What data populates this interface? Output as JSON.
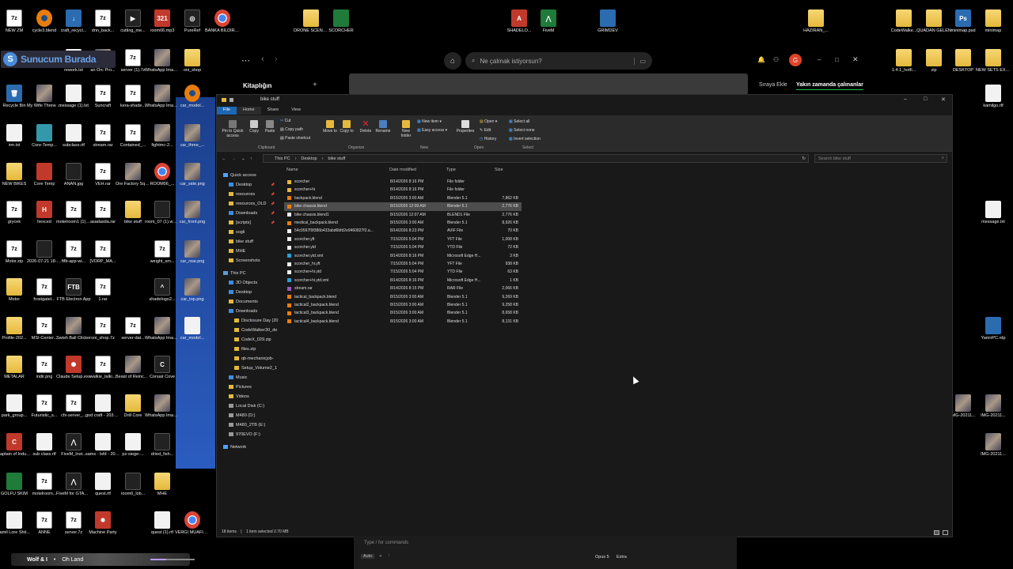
{
  "desktop_icons": [
    {
      "label": "NEW ZM",
      "kind": "z7",
      "glyph": "7z"
    },
    {
      "label": "cycle3.blend",
      "kind": "blender",
      "glyph": ""
    },
    {
      "label": "craft_recycl...",
      "kind": "blue",
      "glyph": "↓"
    },
    {
      "label": "dnn_back...",
      "kind": "z7",
      "glyph": "7z"
    },
    {
      "label": "cutting_me...",
      "kind": "dark",
      "glyph": "▶"
    },
    {
      "label": "room06.mp3",
      "kind": "red",
      "glyph": "321"
    },
    {
      "label": "PureRef",
      "kind": "dark",
      "glyph": "◎"
    },
    {
      "label": "BANKA BILDIRIM.pdf",
      "kind": "chrome",
      "glyph": ""
    },
    {
      "label": "DRONE SCENARIOS",
      "kind": "folder",
      "glyph": ""
    },
    {
      "label": "SCORCHER",
      "kind": "green",
      "glyph": ""
    },
    {
      "label": "SHADELO...",
      "kind": "red",
      "glyph": "A"
    },
    {
      "label": "FiveM",
      "kind": "green",
      "glyph": "⋀"
    },
    {
      "label": "GRIMDEV",
      "kind": "blue",
      "glyph": ""
    },
    {
      "label": "HAZIRAN_...",
      "kind": "folder",
      "glyph": ""
    },
    {
      "label": "CodeWalke...",
      "kind": "folder",
      "glyph": ""
    },
    {
      "label": "QUADAN GELEN",
      "kind": "folder",
      "glyph": ""
    },
    {
      "label": "minimap.psd",
      "kind": "blue",
      "glyph": "Ps"
    },
    {
      "label": "minimap",
      "kind": "folder",
      "glyph": ""
    },
    {
      "label": "rework.txt",
      "kind": "file",
      "glyph": ""
    },
    {
      "label": "an Orc Pro...",
      "kind": "img",
      "glyph": ""
    },
    {
      "label": "server (1).7z",
      "kind": "z7",
      "glyph": "7z"
    },
    {
      "label": "WhatsApp Image 2026...",
      "kind": "img",
      "glyph": ""
    },
    {
      "label": "oni_shop",
      "kind": "folder",
      "glyph": ""
    },
    {
      "label": "1.4.1_hotfi...",
      "kind": "folder",
      "glyph": ""
    },
    {
      "label": "zip",
      "kind": "folder",
      "glyph": ""
    },
    {
      "label": "DESKTOP",
      "kind": "folder",
      "glyph": ""
    },
    {
      "label": "NEW SETS EXPORT",
      "kind": "folder",
      "glyph": ""
    },
    {
      "label": "Recycle Bin",
      "kind": "blue",
      "glyph": "🗑"
    },
    {
      "label": "My Wife Threw Out...",
      "kind": "img",
      "glyph": ""
    },
    {
      "label": "message (1).txt",
      "kind": "file",
      "glyph": ""
    },
    {
      "label": "Suncraft",
      "kind": "z7",
      "glyph": "7z"
    },
    {
      "label": "kera-shade...",
      "kind": "z7",
      "glyph": "7z"
    },
    {
      "label": "WhatsApp Image 2026...",
      "kind": "img",
      "glyph": ""
    },
    {
      "label": "car_model...",
      "kind": "blender",
      "glyph": ""
    },
    {
      "label": "kamilgo.rtf",
      "kind": "file",
      "glyph": ""
    },
    {
      "label": "irm.txt",
      "kind": "file",
      "glyph": ""
    },
    {
      "label": "Core-Temp...",
      "kind": "exe",
      "glyph": ""
    },
    {
      "label": "subclass.rtf",
      "kind": "file",
      "glyph": ""
    },
    {
      "label": "stream.rar",
      "kind": "z7",
      "glyph": "7z"
    },
    {
      "label": "Contained_...",
      "kind": "z7",
      "glyph": "7z"
    },
    {
      "label": "fightmc-2...",
      "kind": "img",
      "glyph": ""
    },
    {
      "label": "car_three_...",
      "kind": "img",
      "glyph": ""
    },
    {
      "label": "NEW BIKES",
      "kind": "folder",
      "glyph": ""
    },
    {
      "label": "Core Temp",
      "kind": "red",
      "glyph": ""
    },
    {
      "label": "ANAN.jpg",
      "kind": "dark",
      "glyph": ""
    },
    {
      "label": "VEH.rar",
      "kind": "z7",
      "glyph": "7z"
    },
    {
      "label": "Ore Factory Squad -...",
      "kind": "img",
      "glyph": ""
    },
    {
      "label": "ROOM06_...",
      "kind": "chrome",
      "glyph": ""
    },
    {
      "label": "car_side.png",
      "kind": "img",
      "glyph": ""
    },
    {
      "label": "grycek",
      "kind": "z7",
      "glyph": "7z"
    },
    {
      "label": "hexced",
      "kind": "red",
      "glyph": "H"
    },
    {
      "label": "motelroom1 (1).rar",
      "kind": "z7",
      "glyph": "7z"
    },
    {
      "label": "asadasda.rar",
      "kind": "z7",
      "glyph": "7z"
    },
    {
      "label": "bike stuff",
      "kind": "folder",
      "glyph": ""
    },
    {
      "label": "room_07 (1).webm",
      "kind": "dark",
      "glyph": ""
    },
    {
      "label": "car_front.png",
      "kind": "img",
      "glyph": ""
    },
    {
      "label": "message.txt",
      "kind": "file",
      "glyph": ""
    },
    {
      "label": "Motor.zip",
      "kind": "z7",
      "glyph": "7z"
    },
    {
      "label": "2026-07-21 18-19-18_7...",
      "kind": "dark",
      "glyph": ""
    },
    {
      "label": "ftfb-app-wi...",
      "kind": "z7",
      "glyph": "7z"
    },
    {
      "label": "[VORP_MA...",
      "kind": "z7",
      "glyph": "7z"
    },
    {
      "label": "weight_sm...",
      "kind": "z7",
      "glyph": "7z"
    },
    {
      "label": "car_rear.png",
      "kind": "img",
      "glyph": ""
    },
    {
      "label": "Motor",
      "kind": "folder",
      "glyph": ""
    },
    {
      "label": "frostgatel...",
      "kind": "z7",
      "glyph": "7z"
    },
    {
      "label": "FTB Electron App",
      "kind": "dark",
      "glyph": "FTB"
    },
    {
      "label": "1.rar",
      "kind": "z7",
      "glyph": "7z"
    },
    {
      "label": "shadelogo2...",
      "kind": "dark",
      "glyph": "^"
    },
    {
      "label": "car_top.png",
      "kind": "img",
      "glyph": ""
    },
    {
      "label": "Profile-202...",
      "kind": "folder",
      "glyph": ""
    },
    {
      "label": "MSI-Center...",
      "kind": "z7",
      "glyph": "7z"
    },
    {
      "label": "Swish Ball Clicker",
      "kind": "img",
      "glyph": ""
    },
    {
      "label": "oni_shop.7z",
      "kind": "z7",
      "glyph": "7z"
    },
    {
      "label": "server-dat...",
      "kind": "z7",
      "glyph": "7z"
    },
    {
      "label": "WhatsApp Image 2026...",
      "kind": "img",
      "glyph": ""
    },
    {
      "label": "car_model...",
      "kind": "file",
      "glyph": ""
    },
    {
      "label": "YamirPC.rdp",
      "kind": "blue",
      "glyph": ""
    },
    {
      "label": "METALAR",
      "kind": "folder",
      "glyph": ""
    },
    {
      "label": "indir.png",
      "kind": "z7",
      "glyph": "7z"
    },
    {
      "label": "Claude Setup.exe",
      "kind": "red",
      "glyph": "✺"
    },
    {
      "label": "walkie_talki...",
      "kind": "z7",
      "glyph": "7z"
    },
    {
      "label": "Beast of Reincarnat...",
      "kind": "img",
      "glyph": ""
    },
    {
      "label": "Corsair Cove",
      "kind": "dark",
      "glyph": "C"
    },
    {
      "label": "park_group...",
      "kind": "file",
      "glyph": ""
    },
    {
      "label": "Futuristic_s...",
      "kind": "z7",
      "glyph": "7z"
    },
    {
      "label": "cfx-server_...",
      "kind": "z7",
      "glyph": "7z"
    },
    {
      "label": "god craft - 2036 - fa...",
      "kind": "file",
      "glyph": ""
    },
    {
      "label": "Drill Core",
      "kind": "folder",
      "glyph": ""
    },
    {
      "label": "WhatsApp Image 2026...",
      "kind": "img",
      "glyph": ""
    },
    {
      "label": "IMG-20211...",
      "kind": "img",
      "glyph": ""
    },
    {
      "label": "IMG-20211...",
      "kind": "img",
      "glyph": ""
    },
    {
      "label": "Captain of Industry",
      "kind": "red",
      "glyph": "C"
    },
    {
      "label": "sub class.rtf",
      "kind": "file",
      "glyph": ""
    },
    {
      "label": "FiveM_Inst...",
      "kind": "dark",
      "glyph": "⋀"
    },
    {
      "label": "sams - lsfd - 2036.rtf",
      "kind": "file",
      "glyph": ""
    },
    {
      "label": "pz-siege-...",
      "kind": "file",
      "glyph": ""
    },
    {
      "label": "dried_fish...",
      "kind": "dark",
      "glyph": ""
    },
    {
      "label": "IMG-20211...",
      "kind": "img",
      "glyph": ""
    },
    {
      "label": "GOLFU SKIM",
      "kind": "green",
      "glyph": ""
    },
    {
      "label": "motelroom...",
      "kind": "z7",
      "glyph": "7z"
    },
    {
      "label": "FiveM for GTAV En...",
      "kind": "dark",
      "glyph": "⋀"
    },
    {
      "label": "quest.rtf",
      "kind": "file",
      "glyph": ""
    },
    {
      "label": "room6_lob...",
      "kind": "dark",
      "glyph": ""
    },
    {
      "label": "MHE",
      "kind": "folder",
      "glyph": ""
    },
    {
      "label": "Kamil Lore Shit (1).docx",
      "kind": "file",
      "glyph": ""
    },
    {
      "label": "ANNE",
      "kind": "z7",
      "glyph": "7z"
    },
    {
      "label": "server.7z",
      "kind": "z7",
      "glyph": "7z"
    },
    {
      "label": "Machine Party",
      "kind": "red",
      "glyph": "✸"
    },
    {
      "label": "quest (1).rtf",
      "kind": "file",
      "glyph": ""
    },
    {
      "label": "VERGI MUAFIYET...",
      "kind": "chrome",
      "glyph": ""
    }
  ],
  "logo": {
    "letter": "S",
    "text": "Sunucum Burada"
  },
  "spotify": {
    "search_placeholder": "Ne çalmak istiyorsun?",
    "library_title": "Kitaplığın",
    "queue_label": "Sıraya Ekle",
    "recent_label": "Yakın zamanda çalınanlar",
    "avatar_letter": "G"
  },
  "explorer": {
    "title": "bike stuff",
    "tabs": [
      "File",
      "Home",
      "Share",
      "View"
    ],
    "ribbon": {
      "pin": "Pin to Quick access",
      "copy": "Copy",
      "paste": "Paste",
      "cut": "Cut",
      "copy_path": "Copy path",
      "paste_shortcut": "Paste shortcut",
      "move_to": "Move to",
      "copy_to": "Copy to",
      "delete": "Delete",
      "rename": "Rename",
      "new_folder": "New folder",
      "new_item": "New item",
      "easy_access": "Easy access",
      "properties": "Properties",
      "open": "Open",
      "edit": "Edit",
      "history": "History",
      "select_all": "Select all",
      "select_none": "Select none",
      "invert_selection": "Invert selection",
      "groups": [
        "Clipboard",
        "Organize",
        "New",
        "Open",
        "Select"
      ]
    },
    "breadcrumb": [
      "This PC",
      "Desktop",
      "bike stuff"
    ],
    "search_placeholder": "Search bike stuff",
    "nav": [
      {
        "label": "Quick access",
        "indent": 0,
        "icon": "star",
        "pinned": false
      },
      {
        "label": "Desktop",
        "indent": 1,
        "icon": "blue",
        "pinned": true
      },
      {
        "label": "resources",
        "indent": 1,
        "icon": "folder",
        "pinned": true
      },
      {
        "label": "resources_OLD",
        "indent": 1,
        "icon": "folder",
        "pinned": true
      },
      {
        "label": "Downloads",
        "indent": 1,
        "icon": "blue",
        "pinned": true
      },
      {
        "label": "[scripts]",
        "indent": 1,
        "icon": "folder",
        "pinned": true
      },
      {
        "label": "sogli",
        "indent": 1,
        "icon": "folder",
        "pinned": false
      },
      {
        "label": "bike stuff",
        "indent": 1,
        "icon": "folder",
        "pinned": false
      },
      {
        "label": "MHE",
        "indent": 1,
        "icon": "folder",
        "pinned": false
      },
      {
        "label": "Screenshots",
        "indent": 1,
        "icon": "folder",
        "pinned": false
      },
      {
        "label": "This PC",
        "indent": 0,
        "icon": "pc",
        "pinned": false
      },
      {
        "label": "3D Objects",
        "indent": 1,
        "icon": "blue",
        "pinned": false
      },
      {
        "label": "Desktop",
        "indent": 1,
        "icon": "blue",
        "pinned": false
      },
      {
        "label": "Documents",
        "indent": 1,
        "icon": "folder",
        "pinned": false
      },
      {
        "label": "Downloads",
        "indent": 1,
        "icon": "blue",
        "pinned": false
      },
      {
        "label": "Disclosure Day (20",
        "indent": 2,
        "icon": "folder",
        "pinned": false
      },
      {
        "label": "CodeWalker30_de",
        "indent": 2,
        "icon": "folder",
        "pinned": false
      },
      {
        "label": "CodeX_029.zip",
        "indent": 2,
        "icon": "zip",
        "pinned": false
      },
      {
        "label": "files.zip",
        "indent": 2,
        "icon": "zip",
        "pinned": false
      },
      {
        "label": "qb-mechanicjob-",
        "indent": 2,
        "icon": "zip",
        "pinned": false
      },
      {
        "label": "Setup_Volume2_1",
        "indent": 2,
        "icon": "zip",
        "pinned": false
      },
      {
        "label": "Music",
        "indent": 1,
        "icon": "blue",
        "pinned": false
      },
      {
        "label": "Pictures",
        "indent": 1,
        "icon": "folder",
        "pinned": false
      },
      {
        "label": "Videos",
        "indent": 1,
        "icon": "folder",
        "pinned": false
      },
      {
        "label": "Local Disk (C:)",
        "indent": 1,
        "icon": "drive",
        "pinned": false
      },
      {
        "label": "M480 (D:)",
        "indent": 1,
        "icon": "drive",
        "pinned": false
      },
      {
        "label": "M480_2TB (E:)",
        "indent": 1,
        "icon": "drive",
        "pinned": false
      },
      {
        "label": "970EVO (F:)",
        "indent": 1,
        "icon": "drive",
        "pinned": false
      },
      {
        "label": "Network",
        "indent": 0,
        "icon": "net",
        "pinned": false
      }
    ],
    "columns": [
      "Name",
      "Date modified",
      "Type",
      "Size"
    ],
    "files": [
      {
        "name": "scorcher",
        "date": "8/14/2026 8:16 PM",
        "type": "File folder",
        "size": "",
        "icon": "folder"
      },
      {
        "name": "scorcher+hi",
        "date": "8/14/2026 8:16 PM",
        "type": "File folder",
        "size": "",
        "icon": "folder"
      },
      {
        "name": "backpack.blend",
        "date": "8/15/2026 3:00 AM",
        "type": "Blender 5.1",
        "size": "7,862 KB",
        "icon": "blender"
      },
      {
        "name": "bike chassis.blend",
        "date": "8/15/2026 12:09 AM",
        "type": "Blender 5.1",
        "size": "2,776 KB",
        "icon": "blender",
        "selected": true
      },
      {
        "name": "bike chassis.blend1",
        "date": "8/15/2026 12:07 AM",
        "type": "BLEND1 File",
        "size": "2,776 KB",
        "icon": "file"
      },
      {
        "name": "medical_backpack.blend",
        "date": "8/15/2026 3:00 AM",
        "type": "Blender 5.1",
        "size": "8,926 KB",
        "icon": "blender"
      },
      {
        "name": "54c9567f9f386b433abd6bfd2e9460827f2.a...",
        "date": "8/14/2026 8:23 PM",
        "type": "AVIF File",
        "size": "70 KB",
        "icon": "file"
      },
      {
        "name": "scorcher.yft",
        "date": "7/15/2026 5:04 PM",
        "type": "YFT File",
        "size": "1,008 KB",
        "icon": "file"
      },
      {
        "name": "scorcher.ytd",
        "date": "7/15/2026 5:04 PM",
        "type": "YTD File",
        "size": "72 KB",
        "icon": "file"
      },
      {
        "name": "scorcher.ytd.xml",
        "date": "8/14/2026 8:16 PM",
        "type": "Microsoft Edge H...",
        "size": "3 KB",
        "icon": "edge"
      },
      {
        "name": "scorcher_hi.yft",
        "date": "7/15/2026 5:04 PM",
        "type": "YFT File",
        "size": "938 KB",
        "icon": "file"
      },
      {
        "name": "scorcher+hi.ytd",
        "date": "7/15/2026 5:04 PM",
        "type": "YTD File",
        "size": "63 KB",
        "icon": "file"
      },
      {
        "name": "scorcher+hi.ytd.xml",
        "date": "8/14/2026 8:16 PM",
        "type": "Microsoft Edge H...",
        "size": "1 KB",
        "icon": "edge"
      },
      {
        "name": "stream.rar",
        "date": "8/14/2026 8:15 PM",
        "type": "RAR File",
        "size": "2,066 KB",
        "icon": "rar"
      },
      {
        "name": "tactical_backpack.blend",
        "date": "8/15/2026 3:00 AM",
        "type": "Blender 5.1",
        "size": "9,269 KB",
        "icon": "blender"
      },
      {
        "name": "tactical2_backpack.blend",
        "date": "8/15/2026 3:00 AM",
        "type": "Blender 5.1",
        "size": "9,258 KB",
        "icon": "blender"
      },
      {
        "name": "tactical3_backpack.blend",
        "date": "8/15/2026 3:00 AM",
        "type": "Blender 5.1",
        "size": "8,658 KB",
        "icon": "blender"
      },
      {
        "name": "tactical4_backpack.blend",
        "date": "8/15/2026 3:00 AM",
        "type": "Blender 5.1",
        "size": "8,131 KB",
        "icon": "blender"
      }
    ],
    "status_count": "18 items",
    "status_selected": "1 item selected 2.70 MB"
  },
  "claude_bar": {
    "placeholder": "Type / for commands",
    "auto": "Auto",
    "model": "Opus 5",
    "effort": "Extra"
  },
  "media": {
    "artist": "Wolf & I",
    "separator": "•",
    "track": "Oh Land",
    "progress": 0.35
  },
  "colors": {
    "accent": "#1e67b4",
    "spotify_green": "#1db954",
    "selected_row": "#4d4d4d"
  }
}
